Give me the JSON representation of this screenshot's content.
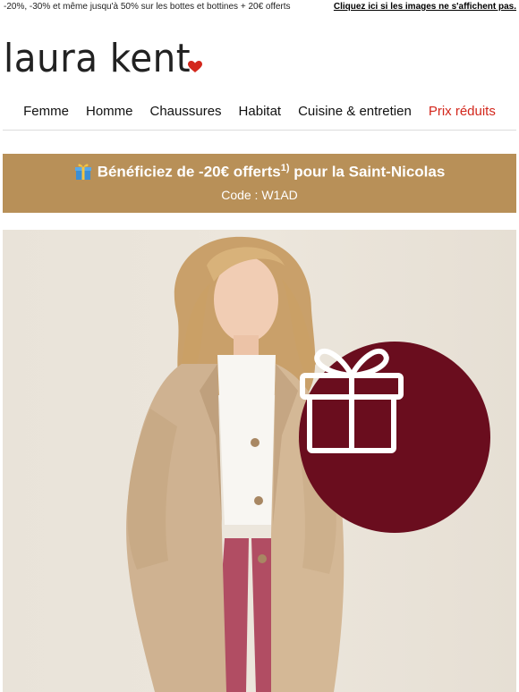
{
  "header": {
    "preheader": "-20%, -30% et même jusqu'à 50% sur les bottes et bottines + 20€ offerts",
    "view_in_browser": "Cliquez ici si les images ne s'affichent pas."
  },
  "brand": {
    "logo_text": "laura kent",
    "heart_color": "#d3271c"
  },
  "nav": {
    "items": [
      {
        "label": "Femme"
      },
      {
        "label": "Homme"
      },
      {
        "label": "Chaussures"
      },
      {
        "label": "Habitat"
      },
      {
        "label": "Cuisine & entretien"
      },
      {
        "label": "Prix réduits"
      }
    ],
    "sale_color": "#d3271c"
  },
  "promo": {
    "icon": "gift-icon",
    "headline": "Bénéficiez de -20€ offerts",
    "footnote": "1)",
    "headline_tail": "pour la Saint-Nicolas",
    "code_line": "Code : W1AD",
    "background": "#b89058"
  },
  "hero": {
    "badge_icon": "gift-icon",
    "badge_color": "#6a0d1e"
  }
}
